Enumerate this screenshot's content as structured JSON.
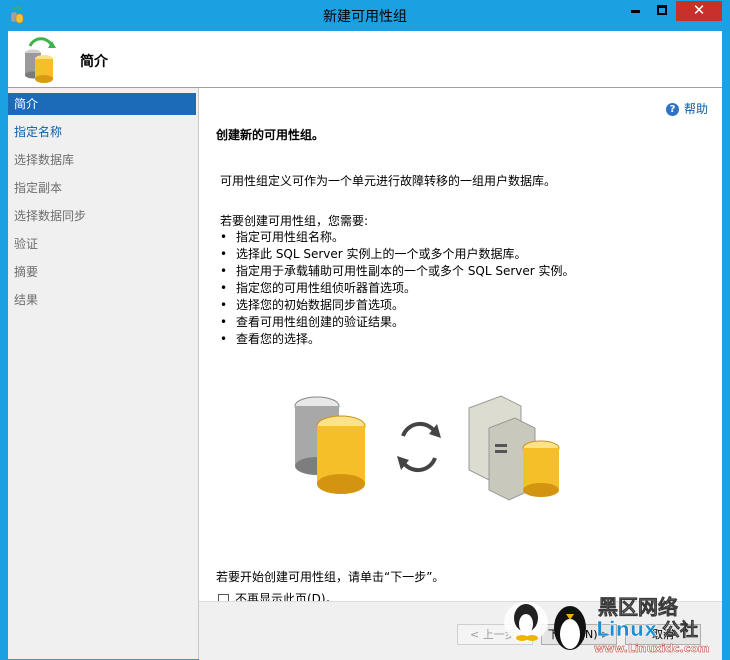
{
  "window": {
    "title": "新建可用性组",
    "close_glyph": "✕"
  },
  "header": {
    "title": "简介"
  },
  "sidebar": {
    "items": [
      {
        "label": "简介",
        "state": "active"
      },
      {
        "label": "指定名称",
        "state": "link"
      },
      {
        "label": "选择数据库",
        "state": "disabled"
      },
      {
        "label": "指定副本",
        "state": "disabled"
      },
      {
        "label": "选择数据同步",
        "state": "disabled"
      },
      {
        "label": "验证",
        "state": "disabled"
      },
      {
        "label": "摘要",
        "state": "disabled"
      },
      {
        "label": "结果",
        "state": "disabled"
      }
    ]
  },
  "content": {
    "help_label": "帮助",
    "heading": "创建新的可用性组。",
    "intro": "可用性组定义可作为一个单元进行故障转移的一组用户数据库。",
    "needs_title": "若要创建可用性组，您需要:",
    "bullets": [
      "指定可用性组名称。",
      "选择此 SQL Server 实例上的一个或多个用户数据库。",
      "指定用于承载辅助可用性副本的一个或多个 SQL Server 实例。",
      "指定您的可用性组侦听器首选项。",
      "选择您的初始数据同步首选项。",
      "查看可用性组创建的验证结果。",
      "查看您的选择。"
    ],
    "start_text": "若要开始创建可用性组，请单击“下一步”。",
    "checkbox_label": "不再显示此页(D)。",
    "checkbox_checked": false
  },
  "footer": {
    "prev_label": "< 上一步(",
    "next_label": "下一步(N) >",
    "cancel_label": "取消"
  },
  "watermark": {
    "text_top": "黑区网络",
    "text_brand": "Linux",
    "text_brand2": "公社",
    "url": "www.Linuxidc.com"
  },
  "colors": {
    "titlebar": "#1ba1e2",
    "nav_active": "#1c6bb8",
    "link": "#0b5ea8",
    "close": "#c7302b"
  }
}
